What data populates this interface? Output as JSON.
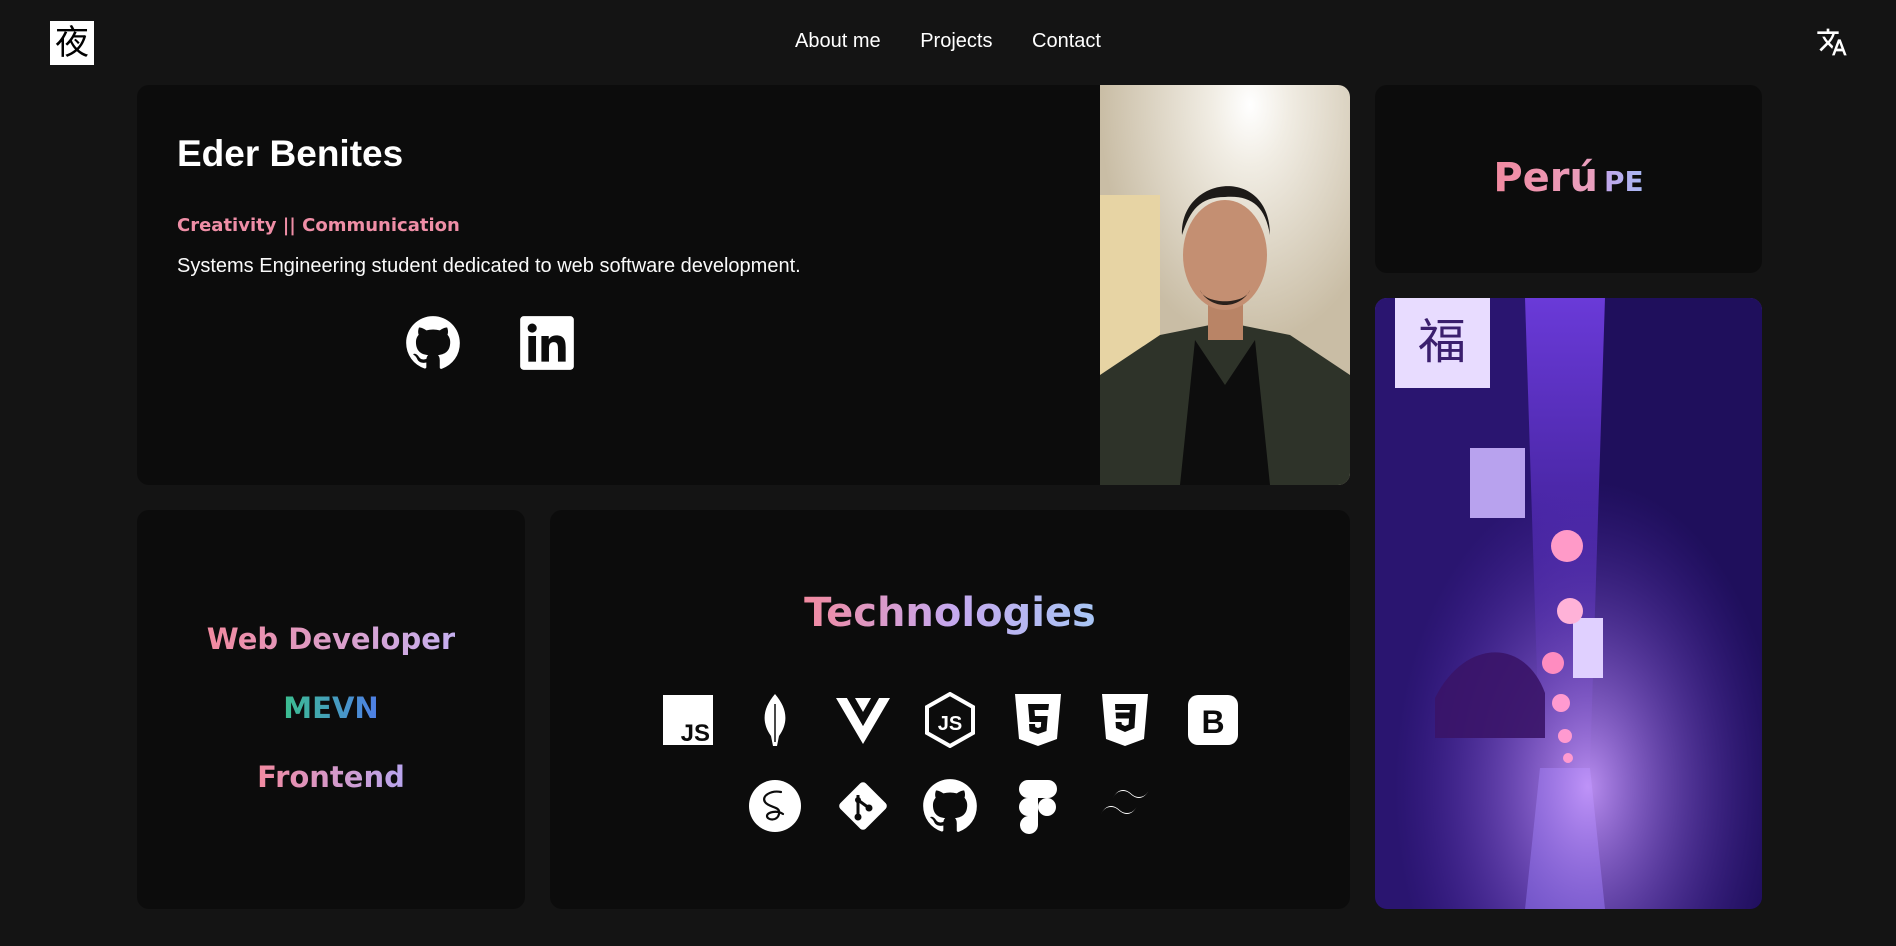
{
  "nav": {
    "logo_text": "夜",
    "links": [
      "About me",
      "Projects",
      "Contact"
    ],
    "translate_icon": "translate-icon"
  },
  "profile": {
    "name": "Eder Benites",
    "tagline": "Creativity || Communication",
    "description": "Systems Engineering student dedicated to web software development.",
    "social": [
      "github-icon",
      "linkedin-icon"
    ]
  },
  "location": {
    "country": "Perú",
    "code": "PE"
  },
  "roles": [
    "Web Developer",
    "MEVN",
    "Frontend"
  ],
  "technologies": {
    "title": "Technologies",
    "icons_row1": [
      "javascript-icon",
      "mongodb-icon",
      "vue-icon",
      "nodejs-icon",
      "html5-icon",
      "css3-icon",
      "bootstrap-icon"
    ],
    "icons_row2": [
      "sass-icon",
      "git-icon",
      "github-icon",
      "figma-icon",
      "tailwind-icon"
    ]
  },
  "colors": {
    "background": "#141414",
    "card": "#0c0c0c",
    "accent_pink": "#f28aa0",
    "accent_lavender": "#c6b0f0",
    "accent_teal": "#3bbf8f",
    "accent_blue": "#4f7ee8"
  }
}
